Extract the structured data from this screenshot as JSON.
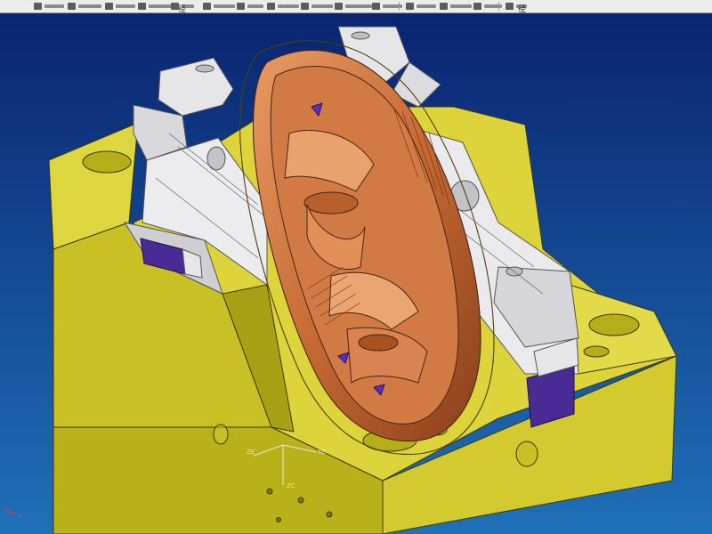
{
  "toolbar": {
    "items": [
      "tool-1",
      "tool-2",
      "tool-3",
      "tool-4",
      "tool-5",
      "tool-6",
      "tool-7",
      "tool-8",
      "tool-9",
      "tool-10",
      "tool-11",
      "tool-12",
      "tool-13",
      "tool-14",
      "tool-15",
      "tool-16"
    ],
    "sub_label_1": "径",
    "sub_label_2": "径"
  },
  "viewport": {
    "background_top": "#0a2470",
    "background_bottom": "#1f70b8",
    "triad_x": "X",
    "triad_label_ze": "ZE",
    "triad_label_xe": "XE",
    "triad_label_zc": "ZC",
    "corner_axis": "x"
  },
  "colors": {
    "mold_base": "#d7cf34",
    "mold_base_side": "#b9b11a",
    "slider": "#e6e6e8",
    "insert": "#c66a33",
    "insert_highlight": "#e79a63",
    "clamp": "#4a2b95"
  }
}
